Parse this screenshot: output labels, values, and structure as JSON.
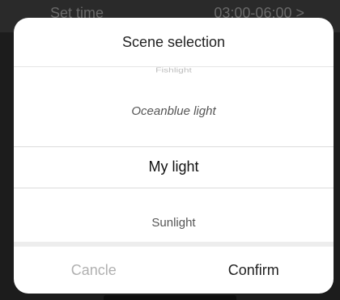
{
  "background": {
    "set_time_label": "Set time",
    "time_range": "03:00-06:00 >"
  },
  "dialog": {
    "title": "Scene selection",
    "picker": {
      "items": [
        "Fishlight",
        "Oceanblue light",
        "My light",
        "Sunlight"
      ],
      "selected": "My light"
    },
    "cancel_label": "Cancle",
    "confirm_label": "Confirm"
  }
}
